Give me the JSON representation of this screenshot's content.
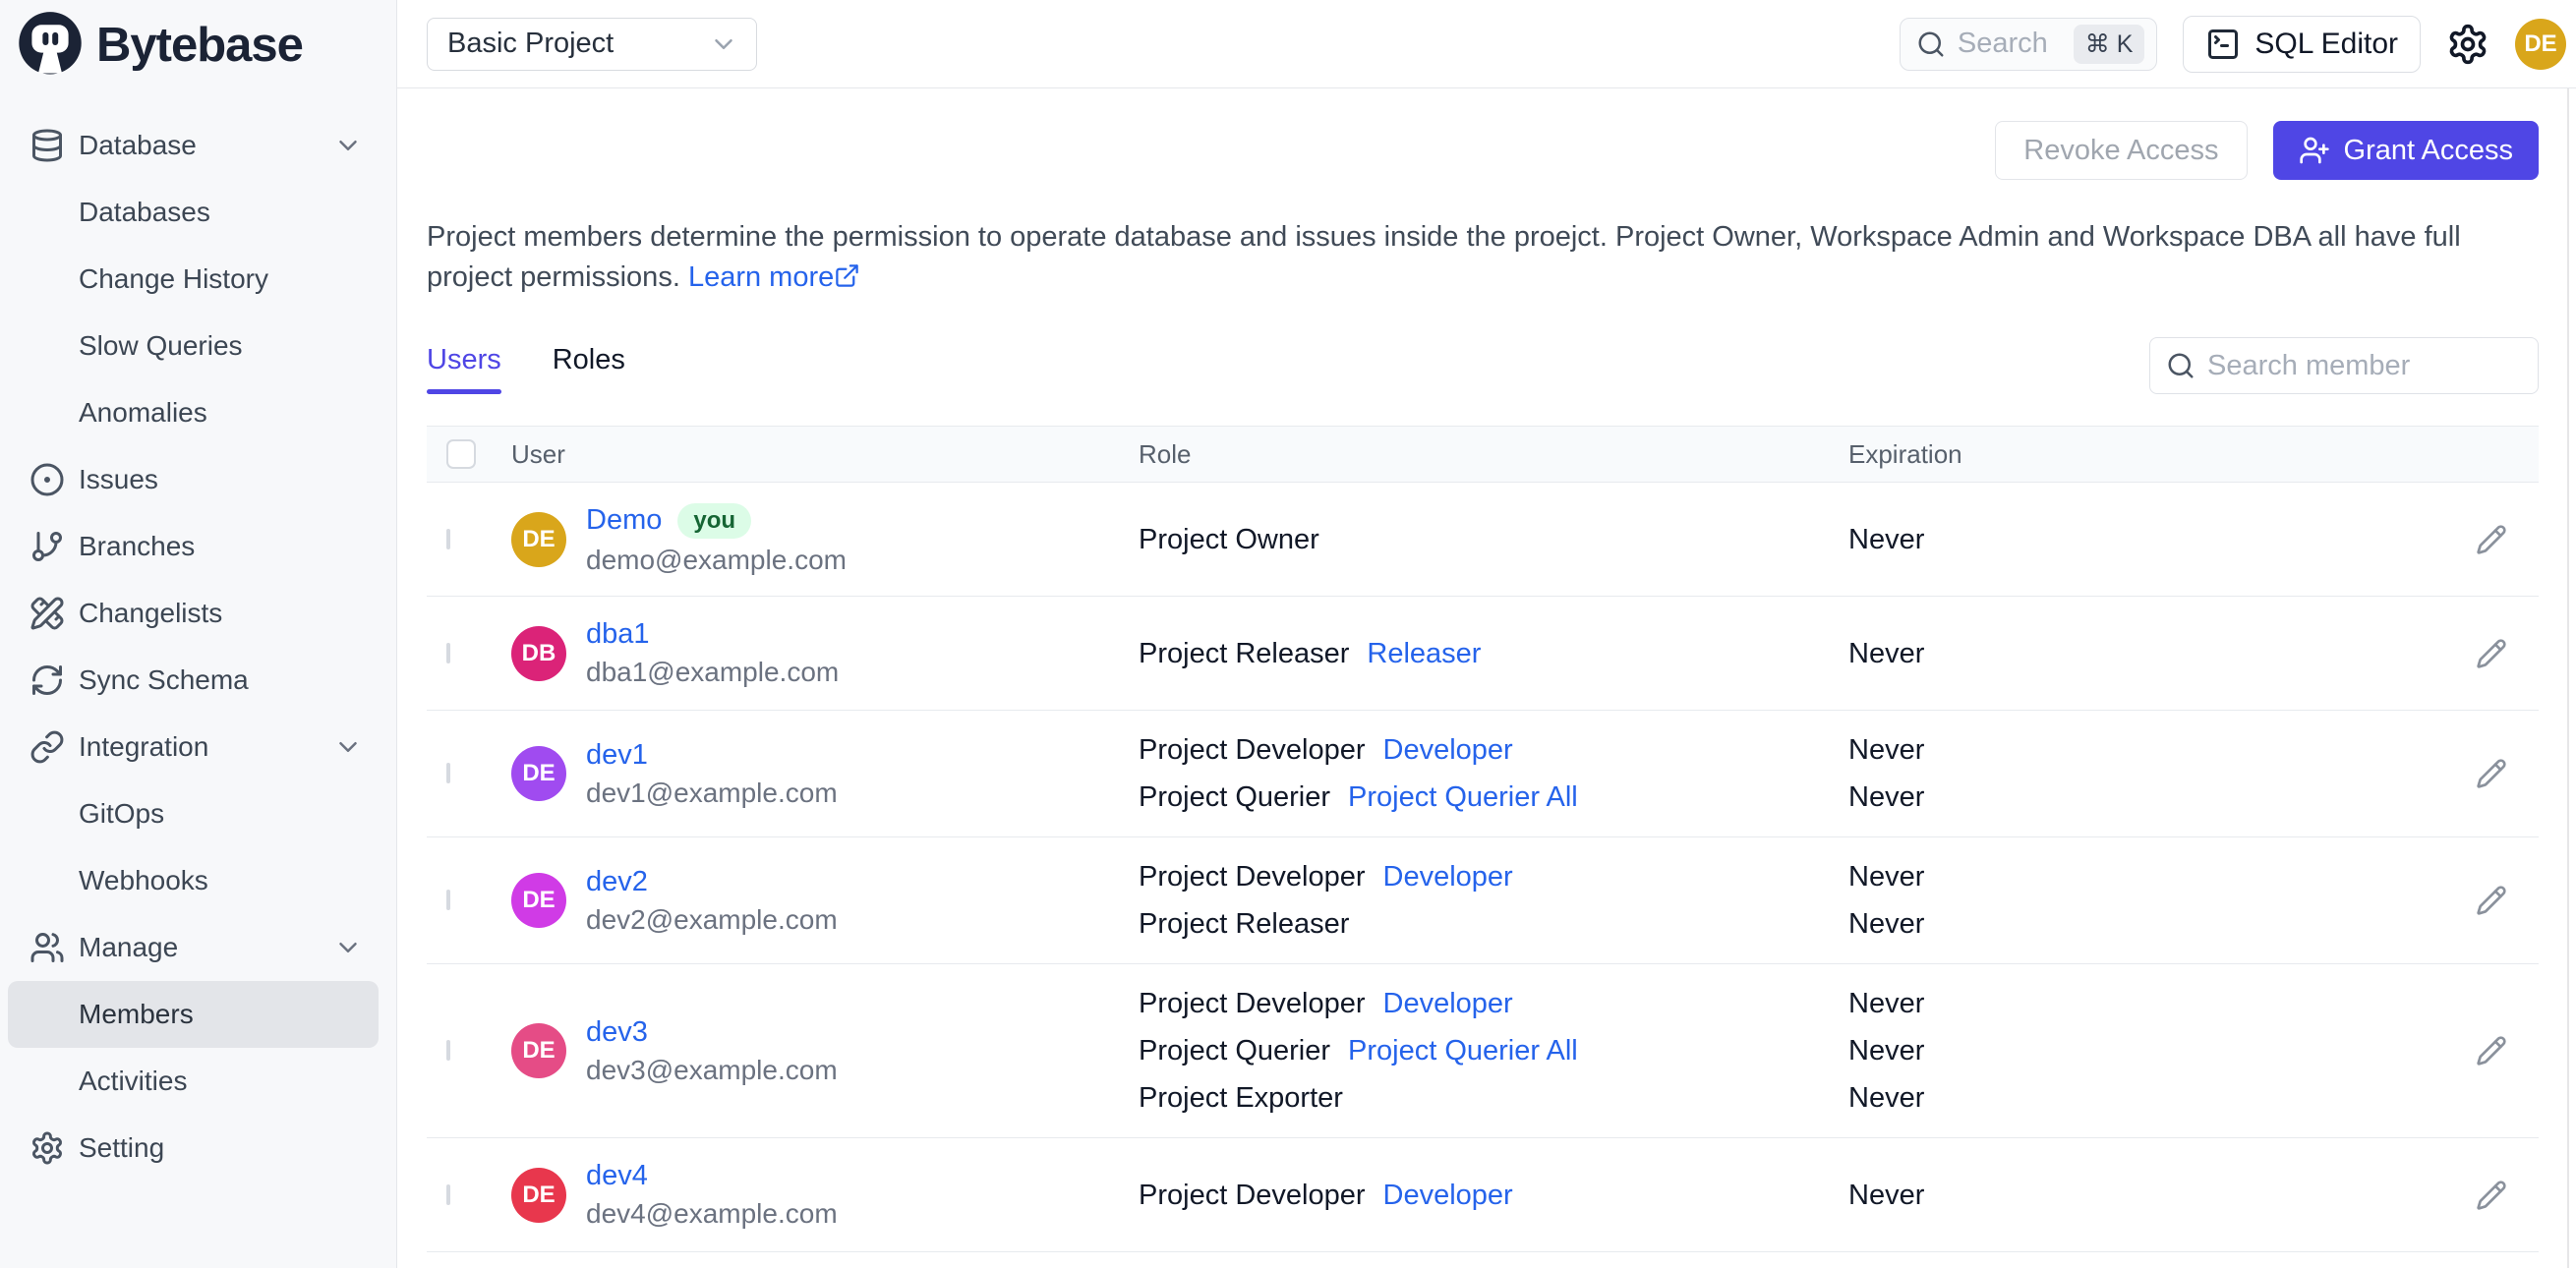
{
  "brand": {
    "name": "Bytebase"
  },
  "topbar": {
    "project_selector": "Basic Project",
    "search_placeholder": "Search",
    "search_shortcut": "⌘ K",
    "sql_editor_label": "SQL Editor",
    "avatar_initials": "DE"
  },
  "sidebar": {
    "items": [
      {
        "label": "Database",
        "icon": "database-icon",
        "level": 1,
        "chevron": true
      },
      {
        "label": "Databases",
        "level": 2
      },
      {
        "label": "Change History",
        "level": 2
      },
      {
        "label": "Slow Queries",
        "level": 2
      },
      {
        "label": "Anomalies",
        "level": 2
      },
      {
        "label": "Issues",
        "icon": "circle-dot-icon",
        "level": 1
      },
      {
        "label": "Branches",
        "icon": "git-branch-icon",
        "level": 1
      },
      {
        "label": "Changelists",
        "icon": "pencil-ruler-icon",
        "level": 1
      },
      {
        "label": "Sync Schema",
        "icon": "refresh-icon",
        "level": 1
      },
      {
        "label": "Integration",
        "icon": "link-icon",
        "level": 1,
        "chevron": true
      },
      {
        "label": "GitOps",
        "level": 2
      },
      {
        "label": "Webhooks",
        "level": 2
      },
      {
        "label": "Manage",
        "icon": "users-icon",
        "level": 1,
        "chevron": true
      },
      {
        "label": "Members",
        "level": 2,
        "active": true
      },
      {
        "label": "Activities",
        "level": 2
      },
      {
        "label": "Setting",
        "icon": "gear-icon",
        "level": 1
      }
    ]
  },
  "main": {
    "actions": {
      "revoke_label": "Revoke Access",
      "grant_label": "Grant Access"
    },
    "description": {
      "text": "Project members determine the permission to operate database and issues inside the proejct. Project Owner, Workspace Admin and Workspace DBA all have full project permissions.",
      "link_label": "Learn more"
    },
    "tabs": [
      {
        "label": "Users",
        "active": true
      },
      {
        "label": "Roles",
        "active": false
      }
    ],
    "member_search_placeholder": "Search member",
    "table": {
      "columns": [
        "User",
        "Role",
        "Expiration"
      ],
      "rows": [
        {
          "initials": "DE",
          "avatar_color": "#D9A61B",
          "name": "Demo",
          "badge": "you",
          "email": "demo@example.com",
          "roles": [
            {
              "label": "Project Owner",
              "link": null
            }
          ],
          "expirations": [
            "Never"
          ]
        },
        {
          "initials": "DB",
          "avatar_color": "#DB2378",
          "name": "dba1",
          "email": "dba1@example.com",
          "roles": [
            {
              "label": "Project Releaser",
              "link": "Releaser"
            }
          ],
          "expirations": [
            "Never"
          ]
        },
        {
          "initials": "DE",
          "avatar_color": "#A04BF0",
          "name": "dev1",
          "email": "dev1@example.com",
          "roles": [
            {
              "label": "Project Developer",
              "link": "Developer"
            },
            {
              "label": "Project Querier",
              "link": "Project Querier All"
            }
          ],
          "expirations": [
            "Never",
            "Never"
          ]
        },
        {
          "initials": "DE",
          "avatar_color": "#D03BE6",
          "name": "dev2",
          "email": "dev2@example.com",
          "roles": [
            {
              "label": "Project Developer",
              "link": "Developer"
            },
            {
              "label": "Project Releaser",
              "link": null
            }
          ],
          "expirations": [
            "Never",
            "Never"
          ]
        },
        {
          "initials": "DE",
          "avatar_color": "#E54C86",
          "name": "dev3",
          "email": "dev3@example.com",
          "roles": [
            {
              "label": "Project Developer",
              "link": "Developer"
            },
            {
              "label": "Project Querier",
              "link": "Project Querier All"
            },
            {
              "label": "Project Exporter",
              "link": null
            }
          ],
          "expirations": [
            "Never",
            "Never",
            "Never"
          ]
        },
        {
          "initials": "DE",
          "avatar_color": "#E8374D",
          "name": "dev4",
          "email": "dev4@example.com",
          "roles": [
            {
              "label": "Project Developer",
              "link": "Developer"
            }
          ],
          "expirations": [
            "Never"
          ]
        }
      ]
    }
  },
  "colors": {
    "accent_indigo": "#4F46E5",
    "link_blue": "#2563EB",
    "badge_green_bg": "#DCFCE7",
    "badge_green_text": "#166534",
    "sidebar_bg": "#F7F8FA",
    "table_header_bg": "#F8FAFC",
    "border": "#E5E7EB"
  }
}
